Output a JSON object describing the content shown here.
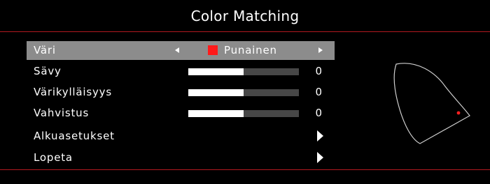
{
  "title": "Color Matching",
  "colors": {
    "accent_line": "#b3191f",
    "selected_row": "#8c8c8c",
    "bar_track": "#474747",
    "bar_fill": "#ffffff",
    "swatch_red": "#ff1a1a",
    "gamut_point": "#ff2020"
  },
  "menu": {
    "color_row": {
      "label": "Väri",
      "value": "Punainen",
      "left_icon": "triangle-left-icon",
      "right_icon": "triangle-right-icon"
    },
    "hue": {
      "label": "Sävy",
      "value": "0",
      "level": 0.5
    },
    "saturation": {
      "label": "Värikylläisyys",
      "value": "0",
      "level": 0.5
    },
    "gain": {
      "label": "Vahvistus",
      "value": "0",
      "level": 0.5
    },
    "reset": {
      "label": "Alkuasetukset",
      "icon": "arrow-right-icon"
    },
    "exit": {
      "label": "Lopeta",
      "icon": "arrow-right-icon"
    }
  }
}
